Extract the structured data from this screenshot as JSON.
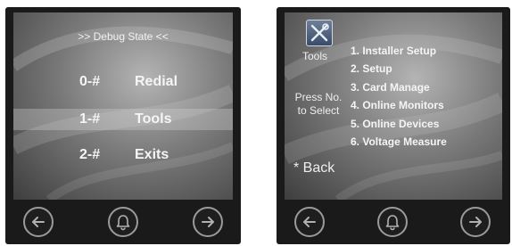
{
  "left_screen": {
    "title": ">> Debug State <<",
    "items": [
      {
        "key": "0-#",
        "label": "Redial",
        "selected": false
      },
      {
        "key": "1-#",
        "label": "Tools",
        "selected": true
      },
      {
        "key": "2-#",
        "label": "Exits",
        "selected": false
      }
    ]
  },
  "right_screen": {
    "icon_label": "Tools",
    "hint": "Press No. to Select",
    "options": [
      "1. Installer Setup",
      "2. Setup",
      "3. Card Manage",
      "4. Online Monitors",
      "5. Online Devices",
      "6. Voltage Measure"
    ],
    "back": "* Back"
  },
  "buttons": [
    "arrow-left-icon",
    "bell-icon",
    "arrow-right-icon"
  ]
}
